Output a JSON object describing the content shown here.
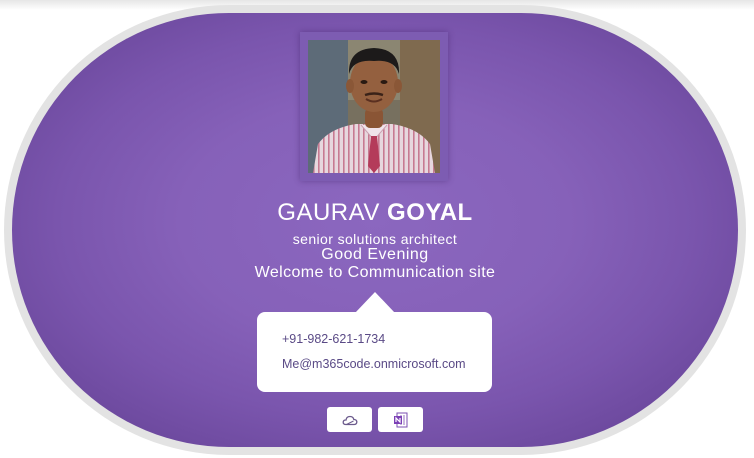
{
  "profile": {
    "first_name": "GAURAV",
    "last_name": "GOYAL",
    "job_title": "senior solutions architect",
    "greeting": "Good Evening",
    "welcome": "Welcome to Communication site"
  },
  "contact": {
    "phone": "+91-982-621-1734",
    "email": "Me@m365code.onmicrosoft.com"
  },
  "actions": [
    {
      "icon": "onedrive-cloud-icon"
    },
    {
      "icon": "onenote-icon"
    }
  ],
  "colors": {
    "card_purple": "#8661b9",
    "card_edge": "#5f3d8f",
    "contact_text": "#5a4a86",
    "outer_ring": "#e3e3e3"
  }
}
